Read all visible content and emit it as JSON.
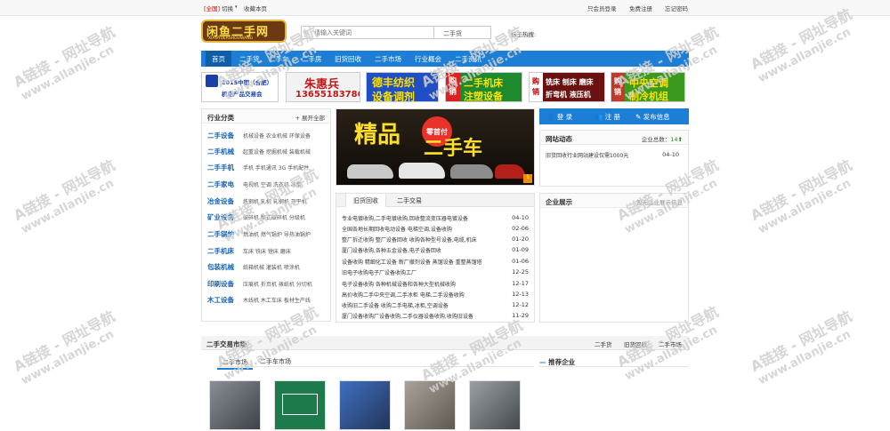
{
  "topbar": {
    "city": "[全国]",
    "switch": "切换",
    "switch_arrow": "▾",
    "favorite": "收藏本页",
    "member_login": "只会员登录",
    "free_register": "免费注册",
    "forgot_password": "忘记密码"
  },
  "header": {
    "logo_text": "闲鱼二手网",
    "logo_sub": "XIANYUERSHOUWANG",
    "search_placeholder": "请输入关键词",
    "search_category": "二手货",
    "hot_search": "标王热搜:"
  },
  "nav": {
    "items": [
      "首页",
      "二手货",
      "二手车",
      "二手房",
      "旧货回收",
      "二手市场",
      "行业概会",
      "二手资讯"
    ]
  },
  "ads": [
    {
      "line1": "2015中国（合肥）",
      "line2": "机电产品交易会"
    },
    {
      "line1": "朱惠兵",
      "line2": "13655183786"
    },
    {
      "line1": "德丰纺织",
      "line2": "设备调剂"
    },
    {
      "line1": "二手机床",
      "line2": "注塑设备",
      "side": "购销"
    },
    {
      "line1": "铣床 刨床 磨床",
      "line2": "折弯机 液压机",
      "side": "购销"
    },
    {
      "line1": "中央空调",
      "line2": "制冷机组",
      "side": "购销"
    }
  ],
  "categories": {
    "title": "行业分类",
    "expand": "展开全部",
    "rows": [
      {
        "name": "二手设备",
        "subs": "机械设备  农业机械  环保设备"
      },
      {
        "name": "二手机械",
        "subs": "起重设备  挖掘机械  装载机械"
      },
      {
        "name": "二手手机",
        "subs": "手机  手机通讯  3G  手机配件"
      },
      {
        "name": "二手家电",
        "subs": "电视机  空调  洗衣机  冰柜"
      },
      {
        "name": "冶金设备",
        "subs": "炼钢机  轧机  轧钢机  开平机"
      },
      {
        "name": "矿业设备",
        "subs": "破碎机  颚式破碎机  分级机"
      },
      {
        "name": "二手锅炉",
        "subs": "燃油机  燃气锅炉  导热油锅炉"
      },
      {
        "name": "二手机床",
        "subs": "车床  铣床  镗床  磨床"
      },
      {
        "name": "包装机械",
        "subs": "纸箱机械  灌装机  喷涂机"
      },
      {
        "name": "印刷设备",
        "subs": "压痕机  折页机  裱纸机  分切机"
      },
      {
        "name": "木工设备",
        "subs": "木线机  木工车床  板材生产线"
      }
    ]
  },
  "banner": {
    "text_main": "精品",
    "text_badge": "零首付",
    "text_second": "二手车",
    "page_num": "1"
  },
  "news_tabs": {
    "tabs": [
      "旧货回收",
      "二手交易"
    ],
    "items": [
      {
        "title": "专业电镀收购,二手电镀收购,回收整流变压器电镀设备",
        "date": "04-10"
      },
      {
        "title": "全国各地长期回收电动设备  电梯空调,设备收购",
        "date": "02-06"
      },
      {
        "title": "整厂拆迁收购 整厂设备回收 收购各种型号设备,电缆,机床",
        "date": "01-20"
      },
      {
        "title": "厦门设备收购,各种五金设备,电子设备回收",
        "date": "01-09"
      },
      {
        "title": "设备收购 精细化工设备 新厂撤剂设备 蒸馏设备 重整蒸馏塔",
        "date": "01-06"
      },
      {
        "title": "旧电子收购电子厂设备收购工厂",
        "date": "12-25"
      },
      {
        "title": "电子设备收购 各种机械设备和各种大型机械收购",
        "date": "12-17"
      },
      {
        "title": "高价收购二手中央空调,二手冰柜 电梯,二手设备收购",
        "date": "12-13"
      },
      {
        "title": "收购旧二手设备 收购二手电梯,冰柜,空调设备",
        "date": "12-12"
      },
      {
        "title": "厦门设备收购厂设备收购,二手仪器设备收购,收购旧设备",
        "date": "11-29"
      }
    ]
  },
  "right_buttons": {
    "login": "登 录",
    "register": "注 册",
    "publish": "发布信息"
  },
  "dynamics": {
    "title": "网站动态",
    "total_label": "企业总数：",
    "total": "14",
    "up_arrow": "⬆",
    "item_title": "旧货回收行业网站建设仅需1000元",
    "item_date": "04-10"
  },
  "companies": {
    "title": "企业展示",
    "note": "暂无企业展示信息"
  },
  "market": {
    "title": "二手交易市场",
    "links": [
      "二手货",
      "旧货回收",
      "二手市场"
    ],
    "sub_tabs": [
      "二手市场",
      "二手车市场"
    ],
    "recommend": "推荐企业"
  },
  "watermark": {
    "line1": "A链接 - 网址导航",
    "line2": "www.allanjie.cn"
  },
  "colors": {
    "nav": "#1c7fd5",
    "nav_active": "#0f5ea8",
    "category": "#1564b8"
  }
}
